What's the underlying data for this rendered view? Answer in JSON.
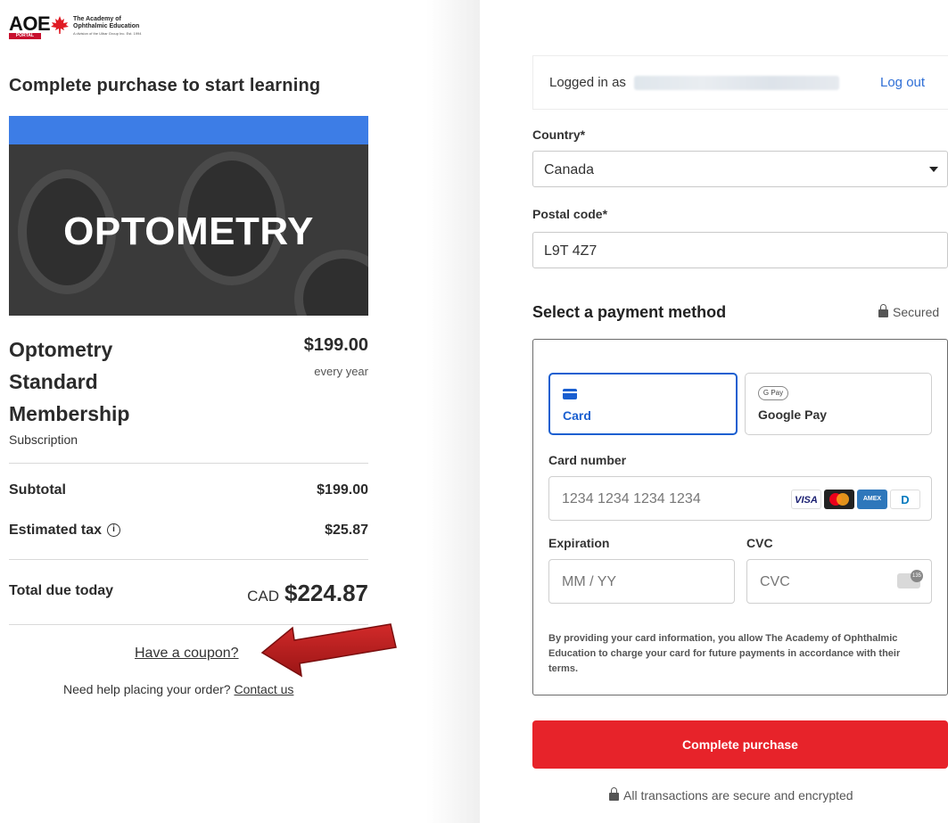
{
  "logo": {
    "brand": "AOE",
    "portal": "PORTAL",
    "org_line1": "The Academy of",
    "org_line2": "Ophthalmic Education",
    "tagline": "A division of the Ulbar Group Inc. Est. 1994"
  },
  "heading": "Complete purchase to start learning",
  "banner": {
    "label": "OPTOMETRY",
    "colors": {
      "top_bar": "#3d7de6",
      "background": "#3a3a3a"
    }
  },
  "product": {
    "name": [
      "Optometry",
      "Standard",
      "Membership"
    ],
    "type": "Subscription",
    "price": "$199.00",
    "period": "every year"
  },
  "summary": {
    "subtotal_label": "Subtotal",
    "subtotal_value": "$199.00",
    "tax_label": "Estimated tax",
    "tax_info_icon": "i",
    "tax_value": "$25.87",
    "total_label": "Total due today",
    "total_currency": "CAD",
    "total_value": "$224.87"
  },
  "coupon_link": "Have a coupon?",
  "help": {
    "text": "Need help placing your order?",
    "link": "Contact us"
  },
  "account": {
    "logged_in_label": "Logged in as",
    "logout": "Log out"
  },
  "form": {
    "country_label": "Country*",
    "country_value": "Canada",
    "postal_label": "Postal code*",
    "postal_value": "L9T 4Z7"
  },
  "payment": {
    "title": "Select a payment method",
    "secured": "Secured",
    "tabs": [
      {
        "label": "Card",
        "icon": "card-icon"
      },
      {
        "label": "Google Pay",
        "icon": "google-pay-icon",
        "badge": "G Pay"
      }
    ],
    "card_number_label": "Card number",
    "card_number_placeholder": "1234 1234 1234 1234",
    "brands": [
      "VISA",
      "AMEX",
      "D"
    ],
    "expiration_label": "Expiration",
    "expiration_placeholder": "MM / YY",
    "cvc_label": "CVC",
    "cvc_placeholder": "CVC",
    "terms": "By providing your card information, you allow The Academy of Ophthalmic Education to charge your card for future payments in accordance with their terms."
  },
  "purchase_button": "Complete purchase",
  "footer_note": "All transactions are secure and encrypted",
  "colors": {
    "accent": "#1a5fd0",
    "purchase": "#e7232a",
    "arrow": "#b01c1c",
    "link": "#2f6fd6"
  }
}
